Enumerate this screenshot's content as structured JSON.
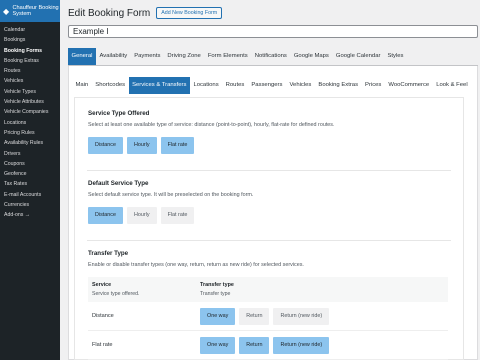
{
  "sidebar": {
    "app_name": "Chauffeur Booking System",
    "items": [
      {
        "label": "Calendar"
      },
      {
        "label": "Bookings"
      },
      {
        "label": "Booking Forms"
      },
      {
        "label": "Booking Extras"
      },
      {
        "label": "Routes"
      },
      {
        "label": "Vehicles"
      },
      {
        "label": "Vehicle Types"
      },
      {
        "label": "Vehicle Attributes"
      },
      {
        "label": "Vehicle Companies"
      },
      {
        "label": "Locations"
      },
      {
        "label": "Pricing Rules"
      },
      {
        "label": "Availability Rules"
      },
      {
        "label": "Drivers"
      },
      {
        "label": "Coupons"
      },
      {
        "label": "Geofence"
      },
      {
        "label": "Tax Rates"
      },
      {
        "label": "E-mail Accounts"
      },
      {
        "label": "Currencies"
      },
      {
        "label": "Add-ons →"
      }
    ]
  },
  "header": {
    "title": "Edit Booking Form",
    "add_new_label": "Add New Booking Form",
    "form_title_value": "Example I"
  },
  "main_tabs": [
    {
      "label": "General"
    },
    {
      "label": "Availability"
    },
    {
      "label": "Payments"
    },
    {
      "label": "Driving Zone"
    },
    {
      "label": "Form Elements"
    },
    {
      "label": "Notifications"
    },
    {
      "label": "Google Maps"
    },
    {
      "label": "Google Calendar"
    },
    {
      "label": "Styles"
    }
  ],
  "sub_tabs": [
    {
      "label": "Main"
    },
    {
      "label": "Shortcodes"
    },
    {
      "label": "Services & Transfers"
    },
    {
      "label": "Locations"
    },
    {
      "label": "Routes"
    },
    {
      "label": "Passengers"
    },
    {
      "label": "Vehicles"
    },
    {
      "label": "Booking Extras"
    },
    {
      "label": "Prices"
    },
    {
      "label": "WooCommerce"
    },
    {
      "label": "Look & Feel"
    }
  ],
  "service_type_offered": {
    "title": "Service Type Offered",
    "description": "Select at least one available type of service: distance (point-to-point), hourly, flat-rate for defined routes.",
    "options": [
      "Distance",
      "Hourly",
      "Flat rate"
    ]
  },
  "default_service_type": {
    "title": "Default Service Type",
    "description": "Select default service type. It will be preselected on the booking form.",
    "options": [
      "Distance",
      "Hourly",
      "Flat rate"
    ]
  },
  "transfer_type": {
    "title": "Transfer Type",
    "description": "Enable or disable transfer types (one way, return, return as new ride) for selected services.",
    "col_service_title": "Service",
    "col_service_sub": "Service type offered.",
    "col_transfer_title": "Transfer type",
    "col_transfer_sub": "Transfer type",
    "rows": [
      {
        "service": "Distance",
        "options": [
          "One way",
          "Return",
          "Return (new ride)"
        ]
      },
      {
        "service": "Flat rate",
        "options": [
          "One way",
          "Return",
          "Return (new ride)"
        ]
      }
    ]
  },
  "colors": {
    "sidebar_bg": "#1d2327",
    "accent": "#2271b1",
    "selected_button": "#8cc4ee",
    "unselected_button": "#f0f0f1"
  }
}
